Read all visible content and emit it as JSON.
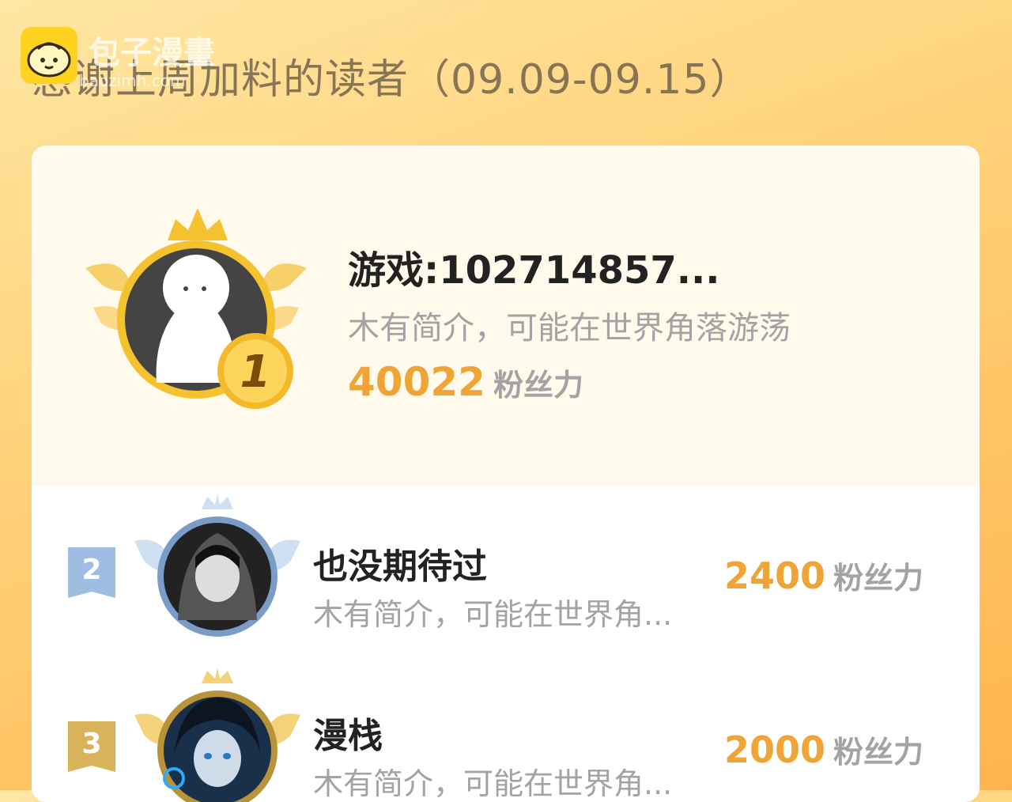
{
  "watermark": {
    "brand": "包子漫畫",
    "url": "baozimh.com"
  },
  "title": "感谢上周加料的读者（09.09-09.15）",
  "leaders": [
    {
      "rank": "1",
      "name": "游戏:102714857...",
      "desc": "木有简介，可能在世界角落游荡",
      "fans": "40022",
      "fans_label": "粉丝力"
    },
    {
      "rank": "2",
      "name": "也没期待过",
      "desc": "木有简介，可能在世界角...",
      "fans": "2400",
      "fans_label": "粉丝力"
    },
    {
      "rank": "3",
      "name": "漫栈",
      "desc": "木有简介，可能在世界角...",
      "fans": "2000",
      "fans_label": "粉丝力"
    }
  ],
  "colors": {
    "gold": "#f1a436",
    "silver": "#9fbde0",
    "bronze": "#d8b35a"
  }
}
